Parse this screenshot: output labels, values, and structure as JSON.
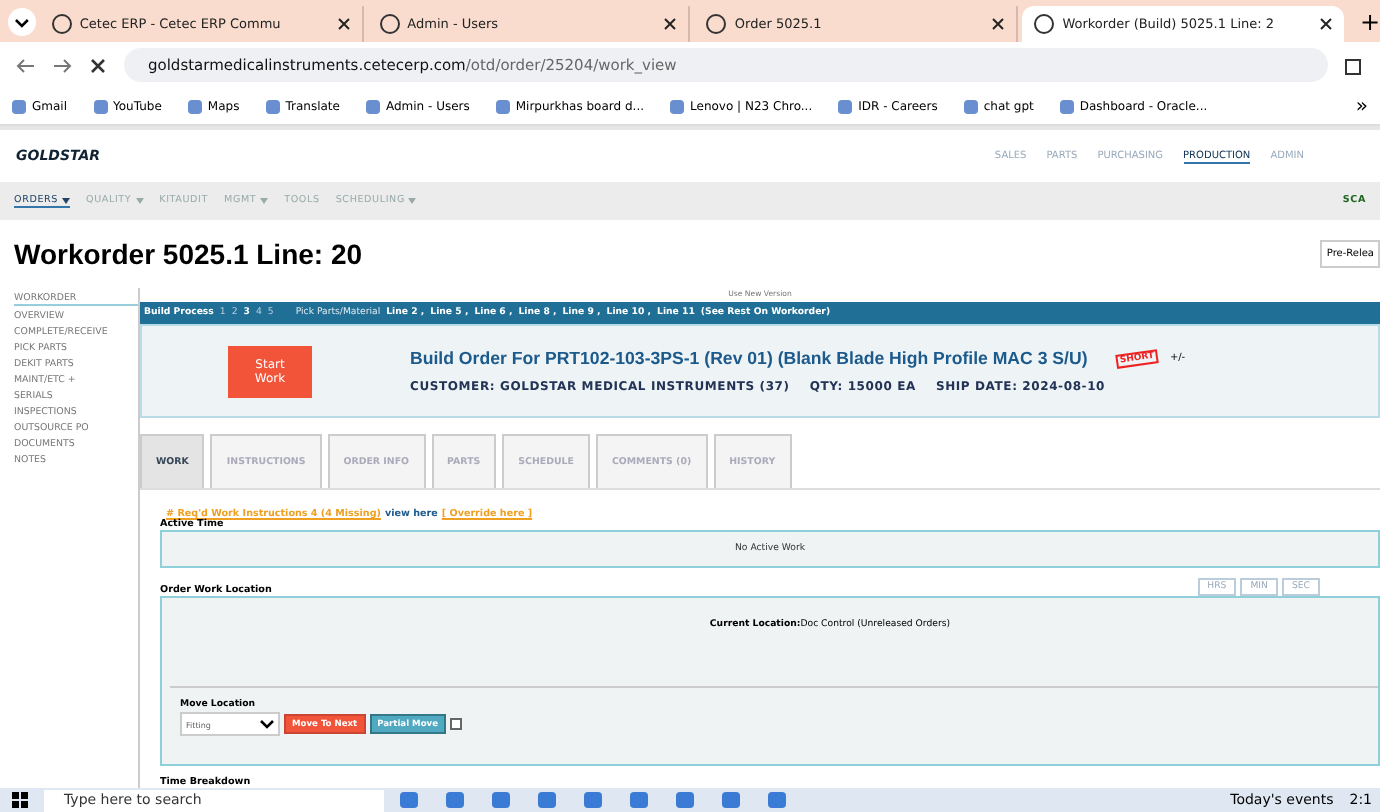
{
  "browser": {
    "tabs": [
      {
        "title": "Cetec ERP - Cetec ERP Commu",
        "selected": false
      },
      {
        "title": "Admin - Users",
        "selected": false
      },
      {
        "title": "Order 5025.1",
        "selected": false
      },
      {
        "title": "Workorder (Build) 5025.1 Line: 2",
        "selected": true
      }
    ],
    "new_tab": "+",
    "url_host": "goldstarmedicalinstruments.cetecerp.com",
    "url_path": "/otd/order/25204/work_view",
    "bookmarks": [
      "Gmail",
      "YouTube",
      "Maps",
      "Translate",
      "Admin - Users",
      "Mirpurkhas board d...",
      "Lenovo | N23 Chro...",
      "IDR - Careers",
      "chat gpt",
      "Dashboard - Oracle..."
    ],
    "more": "»"
  },
  "header": {
    "logo": "GOLDSTAR",
    "modules": [
      {
        "label": "SALES",
        "selected": false
      },
      {
        "label": "PARTS",
        "selected": false
      },
      {
        "label": "PURCHASING",
        "selected": false
      },
      {
        "label": "PRODUCTION",
        "selected": true
      },
      {
        "label": "ADMIN",
        "selected": false
      }
    ]
  },
  "nav": {
    "items": [
      {
        "label": "ORDERS",
        "selected": true,
        "dropdown": true
      },
      {
        "label": "QUALITY",
        "selected": false,
        "dropdown": true
      },
      {
        "label": "KITAUDIT",
        "selected": false,
        "dropdown": false
      },
      {
        "label": "MGMT",
        "selected": false,
        "dropdown": true
      },
      {
        "label": "TOOLS",
        "selected": false,
        "dropdown": false
      },
      {
        "label": "SCHEDULING",
        "selected": false,
        "dropdown": true
      }
    ],
    "right": "SCA"
  },
  "title": "Workorder 5025.1 Line: 20",
  "pre_release": "Pre-Relea",
  "sidebar": {
    "items": [
      {
        "label": "WORKORDER",
        "selected": true
      },
      {
        "label": "OVERVIEW",
        "selected": false
      },
      {
        "label": "COMPLETE/RECEIVE",
        "selected": false
      },
      {
        "label": "PICK PARTS",
        "selected": false
      },
      {
        "label": "DEKIT PARTS",
        "selected": false
      },
      {
        "label": "MAINT/ETC +",
        "selected": false
      },
      {
        "label": "SERIALS",
        "selected": false
      },
      {
        "label": "INSPECTIONS",
        "selected": false
      },
      {
        "label": "OUTSOURCE PO",
        "selected": false
      },
      {
        "label": "DOCUMENTS",
        "selected": false
      },
      {
        "label": "NOTES",
        "selected": false
      }
    ]
  },
  "use_new_version": "Use New Version",
  "build_bar": {
    "label": "Build Process",
    "steps": [
      {
        "label": "1",
        "selected": false
      },
      {
        "label": "2",
        "selected": false
      },
      {
        "label": "3",
        "selected": true
      },
      {
        "label": "4",
        "selected": false
      },
      {
        "label": "5",
        "selected": false
      }
    ],
    "pick_label": "Pick Parts/Material",
    "lines": [
      "Line 2 ,",
      "Line 5 ,",
      "Line 6 ,",
      "Line 8 ,",
      "Line 9 ,",
      "Line 10 ,",
      "Line 11"
    ],
    "rest": "(See Rest On Workorder)"
  },
  "order": {
    "start_button": "Start Work",
    "title": "Build Order For PRT102-103-3PS-1 (Rev 01) (Blank Blade High Profile MAC 3 S/U)",
    "stamp": "SHORT",
    "toggle": "+/-",
    "customer": "CUSTOMER: GOLDSTAR MEDICAL INSTRUMENTS (37)",
    "qty": "QTY: 15000 EA",
    "ship_date": "SHIP DATE: 2024-08-10"
  },
  "tabs": [
    {
      "label": "WORK",
      "selected": true
    },
    {
      "label": "INSTRUCTIONS",
      "selected": false
    },
    {
      "label": "ORDER INFO",
      "selected": false
    },
    {
      "label": "PARTS",
      "selected": false
    },
    {
      "label": "SCHEDULE",
      "selected": false
    },
    {
      "label": "COMMENTS (0)",
      "selected": false
    },
    {
      "label": "HISTORY",
      "selected": false
    }
  ],
  "instructions_warning": "# Req'd Work Instructions 4 (4 Missing)",
  "view_link": "view here",
  "override_link": "[ Override here ]",
  "active_time": {
    "label": "Active Time",
    "message": "No Active Work"
  },
  "location": {
    "label": "Order Work Location",
    "units": [
      {
        "label": "HRS"
      },
      {
        "label": "MIN"
      },
      {
        "label": "SEC"
      }
    ],
    "current_label": "Current Location:",
    "current_value": "Doc Control (Unreleased Orders)",
    "move_label": "Move Location",
    "select_value": "Fitting",
    "move_next": "Move To Next",
    "partial_move": "Partial Move",
    "checked": false
  },
  "time_breakdown": "Time Breakdown",
  "taskbar": {
    "search_placeholder": "Type here to search",
    "events": "Today's events",
    "clock": "2:1"
  }
}
